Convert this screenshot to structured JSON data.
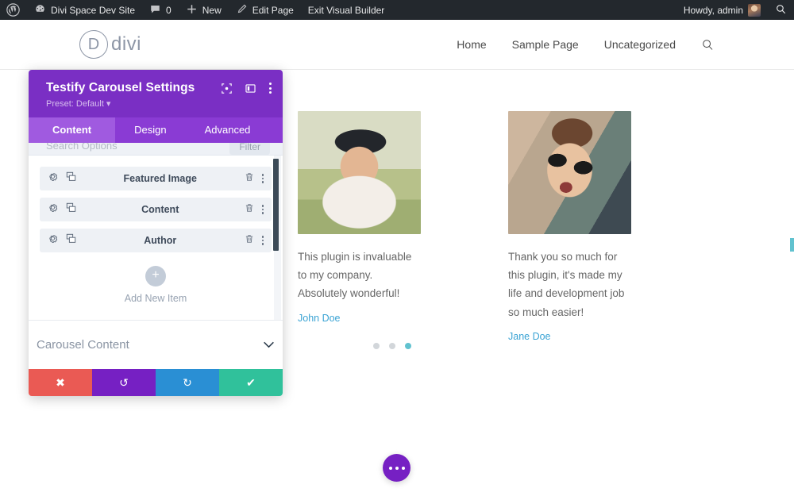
{
  "adminbar": {
    "wp_logo_icon": "wordpress-icon",
    "site_name": "Divi Space Dev Site",
    "site_icon": "dashboard-icon",
    "comments_icon": "comment-bubble-icon",
    "comments_count": "0",
    "new_icon": "plus-icon",
    "new_label": "New",
    "edit_icon": "pencil-icon",
    "edit_label": "Edit Page",
    "exit_label": "Exit Visual Builder",
    "howdy": "Howdy, admin",
    "avatar_icon": "user-avatar",
    "search_icon": "search-icon"
  },
  "siteheader": {
    "logo_mark": "D",
    "logo_text": "divi",
    "nav": [
      {
        "label": "Home"
      },
      {
        "label": "Sample Page"
      },
      {
        "label": "Uncategorized"
      }
    ],
    "search_icon": "search-icon"
  },
  "carousel": {
    "slides": [
      {
        "image_alt": "smiling-man-in-cap-outdoors",
        "quote": "This plugin is invaluable to my company. Absolutely wonderful!",
        "author": "John Doe"
      },
      {
        "image_alt": "woman-with-sunglasses-making-peace-signs",
        "quote": "Thank you so much for this plugin, it's made my life and development job so much easier!",
        "author": "Jane Doe"
      }
    ],
    "next_arrow_icon": "chevron-right-icon",
    "dots": [
      {
        "active": false
      },
      {
        "active": false
      },
      {
        "active": true
      }
    ],
    "accent_color": "#61c2cf",
    "author_link_color": "#3aa3d4"
  },
  "fab": {
    "icon": "ellipsis-icon",
    "color": "#7620c3"
  },
  "modal": {
    "title": "Testify Carousel Settings",
    "preset": "Preset: Default",
    "preset_caret": "▾",
    "header_icons": [
      {
        "name": "focus-target-icon"
      },
      {
        "name": "layout-panel-icon"
      },
      {
        "name": "vertical-kebab-icon"
      }
    ],
    "tabs": [
      {
        "label": "Content",
        "active": true
      },
      {
        "label": "Design",
        "active": false
      },
      {
        "label": "Advanced",
        "active": false
      }
    ],
    "search_row": {
      "label": "Search Options",
      "filter_label": "Filter"
    },
    "items": [
      {
        "label": "Featured Image",
        "settings_icon": "gear-icon",
        "duplicate_icon": "duplicate-icon",
        "delete_icon": "trash-icon",
        "more_icon": "vertical-kebab-icon"
      },
      {
        "label": "Content",
        "settings_icon": "gear-icon",
        "duplicate_icon": "duplicate-icon",
        "delete_icon": "trash-icon",
        "more_icon": "vertical-kebab-icon"
      },
      {
        "label": "Author",
        "settings_icon": "gear-icon",
        "duplicate_icon": "duplicate-icon",
        "delete_icon": "trash-icon",
        "more_icon": "vertical-kebab-icon"
      }
    ],
    "add_new": {
      "icon": "plus-icon",
      "label": "Add New Item"
    },
    "section_toggle": {
      "label": "Carousel Content",
      "chevron": "chevron-down-icon"
    },
    "footer_buttons": [
      {
        "name": "discard-button",
        "glyph": "✖",
        "color": "#ea5a54"
      },
      {
        "name": "undo-button",
        "glyph": "↺",
        "color": "#7620c3"
      },
      {
        "name": "redo-button",
        "glyph": "↻",
        "color": "#2a8fd4"
      },
      {
        "name": "save-button",
        "glyph": "✔",
        "color": "#30c19b"
      }
    ],
    "header_color": "#7a2fc4",
    "tabbar_color": "#8a3bd4",
    "active_tab_color": "#a05ae0"
  }
}
